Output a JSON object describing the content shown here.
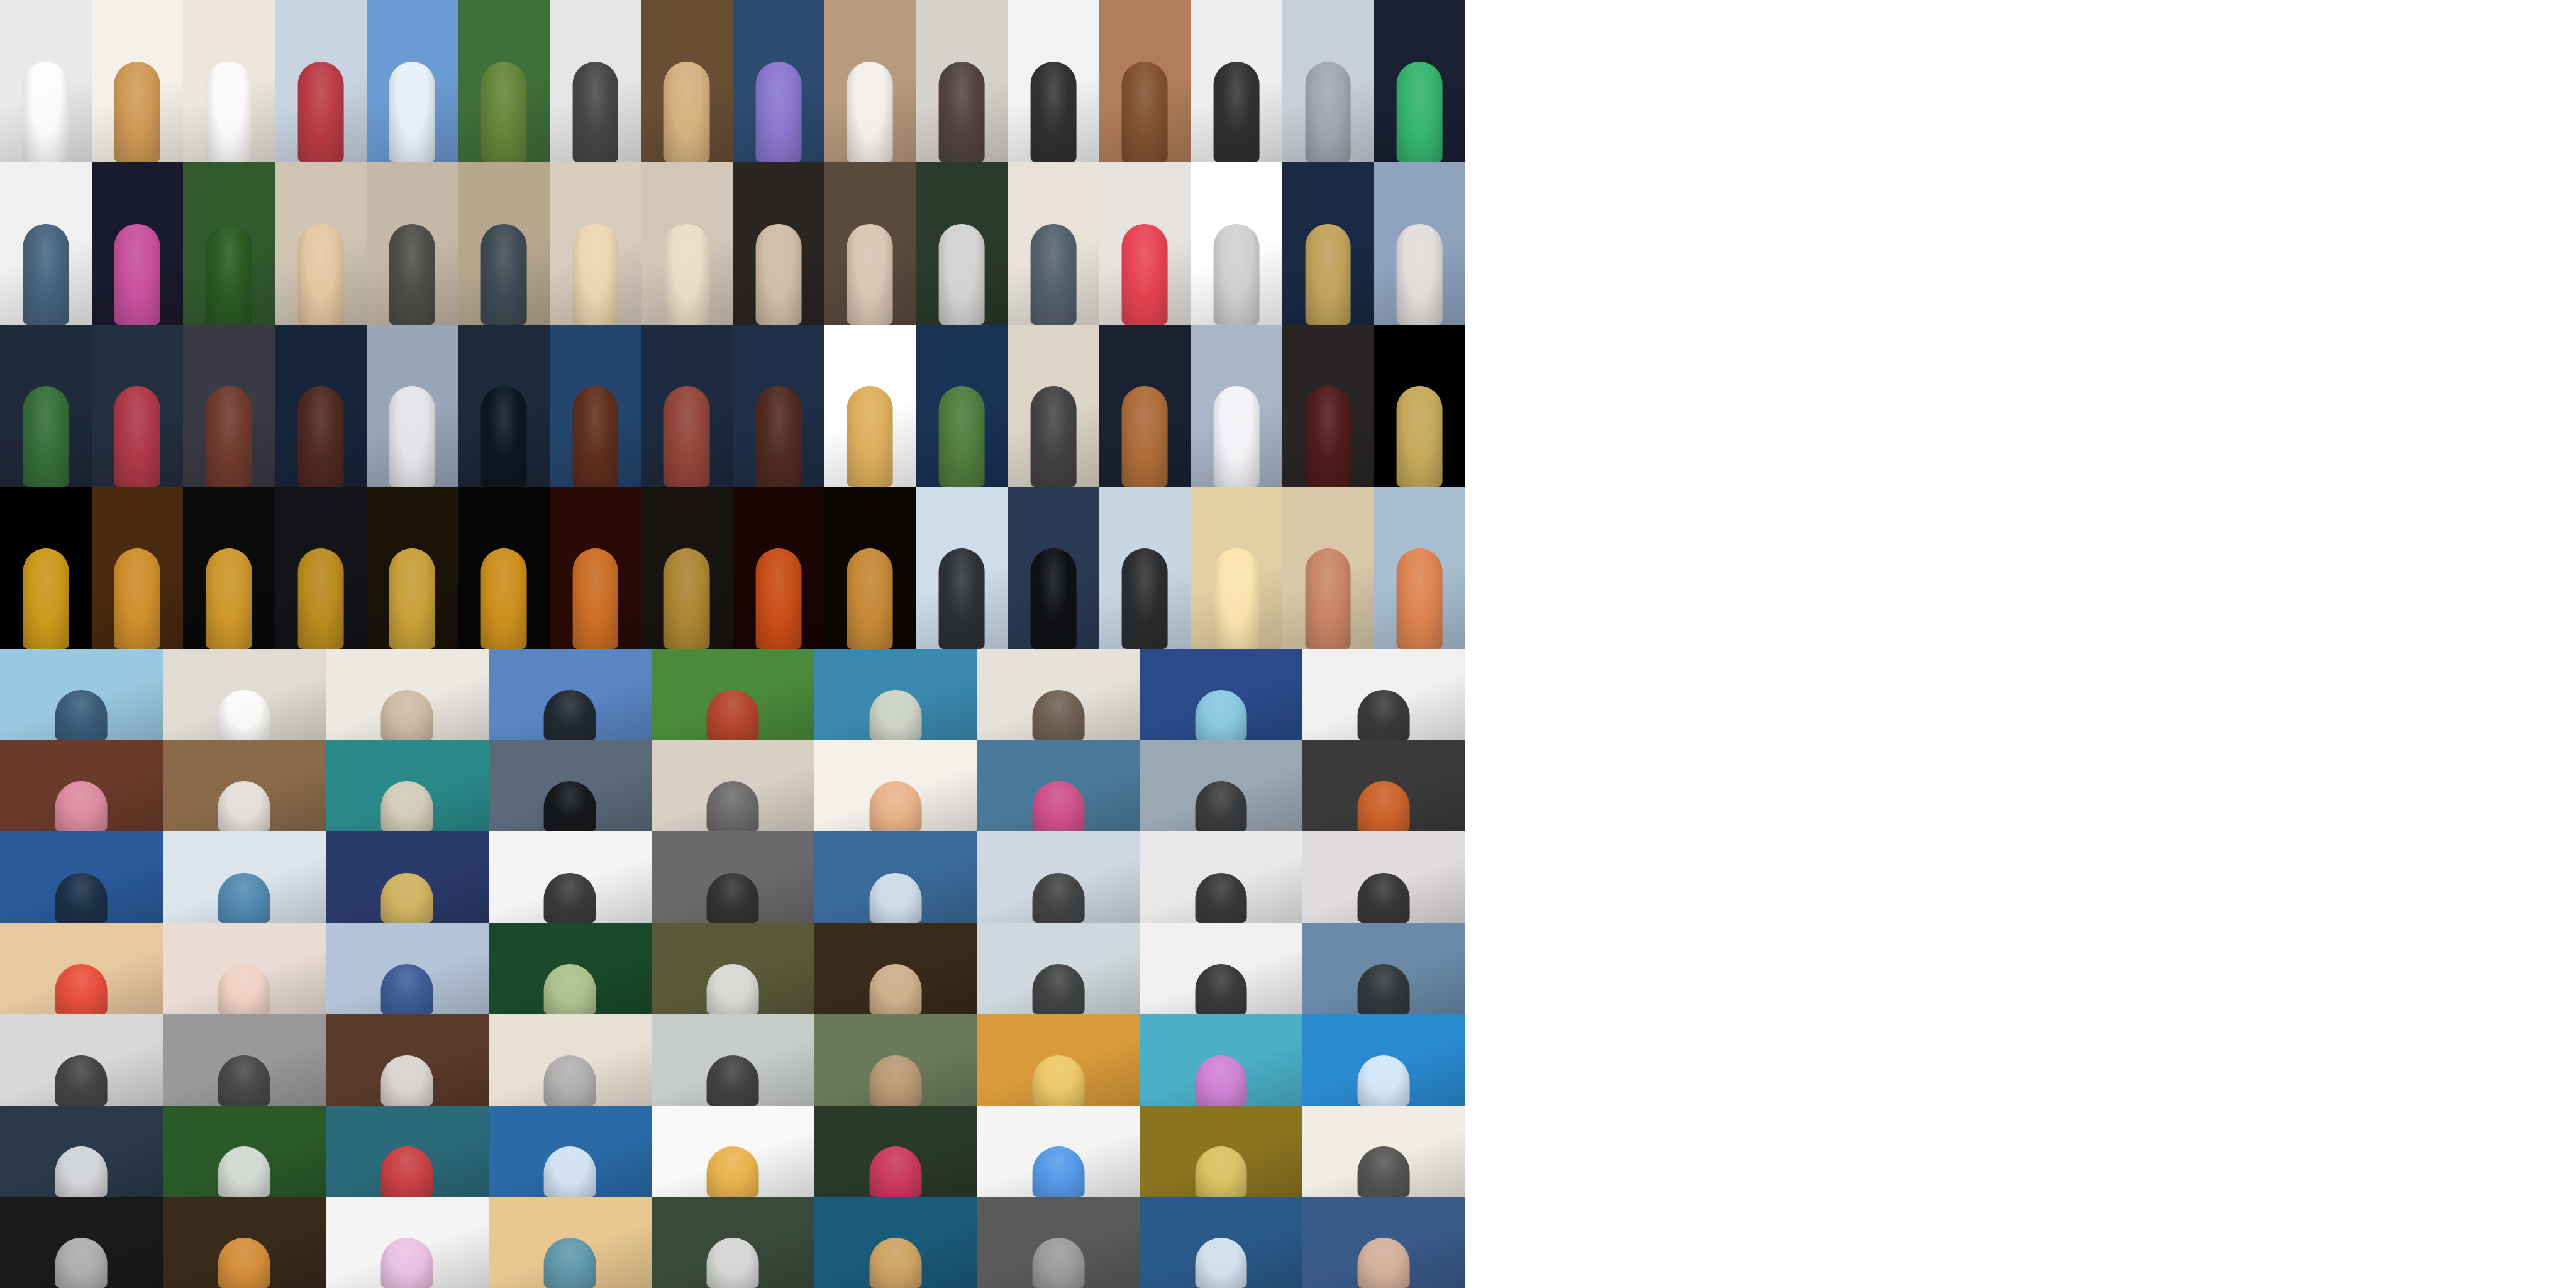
{
  "sheet": {
    "portrait_block": {
      "rows": 4,
      "cols": 16,
      "tiles": [
        [
          "#e9e9e9",
          "#f5f1ea",
          "#ece6dc",
          "#c9d4e2",
          "#6b9bd2",
          "#3f6f3a",
          "#e6e6e6",
          "#6a4e34",
          "#2c4c72",
          "#b89a7e",
          "#d8d2cc",
          "#f0f2f4",
          "#b27d5a",
          "#eeeeee",
          "#c9cfd6",
          "#1a2032"
        ],
        [
          "#f0f0f0",
          "#1a1a2e",
          "#335a2e",
          "#cfc4b2",
          "#c4b8a6",
          "#b7a78f",
          "#d8ccbc",
          "#d2c6b6",
          "#2a2622",
          "#5a4a3c",
          "#2a3a2c",
          "#e8e2d8",
          "#e5e2df",
          "#ffffff",
          "#1a2a44",
          "#8fa3bf"
        ],
        [
          "#1f2a3a",
          "#243040",
          "#3a3a44",
          "#17253a",
          "#9aa6b8",
          "#1c2a3a",
          "#24466e",
          "#1d2a40",
          "#1f2f48",
          "#ffffff",
          "#1a3256",
          "#dcd4c8",
          "#1a2232",
          "#a8b6c8",
          "#2a2626",
          "#000000"
        ],
        [
          "#000000",
          "#4a2a10",
          "#0a0a0a",
          "#141418",
          "#1a1408",
          "#060606",
          "#2a0a04",
          "#181410",
          "#1a0404",
          "#0a0604",
          "#cfdcea",
          "#2a3a54",
          "#c8d6e4",
          "#e2cfa4",
          "#d8c8a8",
          "#a8bed0"
        ]
      ],
      "accents": [
        [
          "#ffffff",
          "#c88a3c",
          "#ffffff",
          "#b8202a",
          "#ffffff",
          "#6a8a3a",
          "#2a2a2a",
          "#e8c48c",
          "#9a7fe0",
          "#ffffff",
          "#3a2a2a",
          "#101010",
          "#7a4a2a",
          "#101010",
          "#9aa0a8",
          "#3ad07a"
        ],
        [
          "#2a4a6a",
          "#e85ab0",
          "#2a5a22",
          "#e8c8a0",
          "#3a3a3a",
          "#2a3a4a",
          "#f0d8b0",
          "#f0e0c8",
          "#eed8c0",
          "#f0dcc8",
          "#f0f0f0",
          "#3a4a5a",
          "#e8283a",
          "#c8c8c8",
          "#e0b860",
          "#f0e8e0"
        ],
        [
          "#3a7a3a",
          "#c83a4a",
          "#7a3a2a",
          "#5a2a1a",
          "#f0f0f0",
          "#0a1420",
          "#6a2a10",
          "#a84a3a",
          "#5a2a1a",
          "#d8a040",
          "#5a8a3a",
          "#2a2a2a",
          "#c87a3a",
          "#ffffff",
          "#5a1a1a",
          "#e8c86a"
        ],
        [
          "#f0b420",
          "#e8a030",
          "#f0b030",
          "#d8a020",
          "#e8b840",
          "#f0a820",
          "#e8802a",
          "#c89a3a",
          "#e85a1a",
          "#e8a040",
          "#101418",
          "#0a0a0a",
          "#101010",
          "#ffe8b0",
          "#c87a5a",
          "#e87a3a"
        ]
      ]
    },
    "landscape_block": {
      "rows": 7,
      "cols": 9,
      "tiles": [
        [
          "#9ac8e0",
          "#e0dcd4",
          "#ece8e2",
          "#5a86c4",
          "#4a8a3a",
          "#3a8ab0",
          "#e6e2da",
          "#2a4a8a",
          "#f0f0f0"
        ],
        [
          "#6a3a2a",
          "#8a6a4a",
          "#2a8a8a",
          "#5a6a7a",
          "#d8d0c4",
          "#f4f0ea",
          "#4a7a9a",
          "#9aa8b4",
          "#3a3a3a"
        ],
        [
          "#2a5a9a",
          "#dce4ec",
          "#2a3a6a",
          "#f4f4f4",
          "#6a6a6a",
          "#3a6a9a",
          "#cfd8e0",
          "#e8e8e8",
          "#e0dcdc"
        ],
        [
          "#e8c8a0",
          "#e8dcd4",
          "#b4c4d8",
          "#1a4a2a",
          "#5a5a3a",
          "#3a2a1a",
          "#cfd8dc",
          "#f0f0f0",
          "#6a8aa8"
        ],
        [
          "#d8d8d8",
          "#9a9898",
          "#5a3a2a",
          "#e8e0d4",
          "#c8ccc8",
          "#6a7a5a",
          "#d89a3a",
          "#4ab0c8",
          "#2a8ad0"
        ],
        [
          "#2a3a4a",
          "#2a5a2a",
          "#2a6a7a",
          "#2a6aa8",
          "#f8f8f8",
          "#2a3a2a",
          "#f4f4f4",
          "#8a7420",
          "#f0ece4"
        ],
        [
          "#1a1a1a",
          "#3a2a1a",
          "#f4f4f4",
          "#e8c890",
          "#3a4a3a",
          "#1a5a7a",
          "#5a5a5a",
          "#2a5a8a",
          "#3a5a8a"
        ]
      ],
      "accents": [
        [
          "#2a4a6a",
          "#ffffff",
          "#c8b49a",
          "#1a1a1a",
          "#c83a2a",
          "#e8e0c8",
          "#5a4a3a",
          "#9ae0f0",
          "#1a1a1a"
        ],
        [
          "#f09ab8",
          "#f4f4f4",
          "#f0d8c0",
          "#0a0a0a",
          "#5a5a5a",
          "#e8a87a",
          "#e84a8a",
          "#2a2a2a",
          "#e86a2a"
        ],
        [
          "#1a2a3a",
          "#3a7aa8",
          "#f0c860",
          "#1a1a1a",
          "#2a2a2a",
          "#e8f0f8",
          "#2a2a2a",
          "#1a1a1a",
          "#1a1a1a"
        ],
        [
          "#e83a2a",
          "#f0d0c0",
          "#2a4a8a",
          "#c8d8a0",
          "#f0f0f0",
          "#e8c8a0",
          "#2a2a2a",
          "#1a1a1a",
          "#2a2a2a"
        ],
        [
          "#2a2a2a",
          "#3a3a3a",
          "#f0f0f0",
          "#a8a8a8",
          "#2a2a2a",
          "#c8a07a",
          "#f0d070",
          "#e87ad8",
          "#f0f8ff"
        ],
        [
          "#f0f0f0",
          "#f0f0f0",
          "#e83a3a",
          "#f0f8ff",
          "#e8a830",
          "#e83a6a",
          "#3a8ae8",
          "#e8d070",
          "#3a3a3a"
        ],
        [
          "#c8c8c8",
          "#f0a040",
          "#e8b8e0",
          "#4a90b0",
          "#f0f0f0",
          "#f0b060",
          "#a8a8a8",
          "#f0f8ff",
          "#f0c0a0"
        ]
      ]
    }
  }
}
